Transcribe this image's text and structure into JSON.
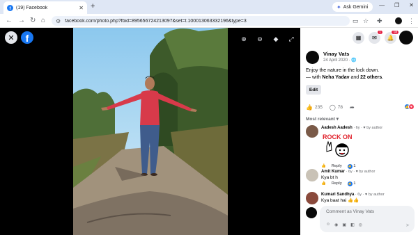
{
  "browser": {
    "tab_title": "(19) Facebook",
    "tab_close": "✕",
    "new_tab": "+",
    "ask_gemini": "Ask Gemini",
    "url": "facebook.com/photo.php?fbid=895656724213097&set=t.100013063332196&type=3",
    "window_controls": [
      "—",
      "❐",
      "✕"
    ]
  },
  "viewer": {
    "close_label": "✕",
    "logo": "f",
    "icons": [
      "zoom-in-icon",
      "zoom-out-icon",
      "tag-icon",
      "fullscreen-icon"
    ]
  },
  "header": {
    "messenger_badge": "1",
    "notifications_badge": "18"
  },
  "post": {
    "author": "Vinay Vats",
    "date": "24 April 2020 · ",
    "text": "Enjoy the nature in the lock down.",
    "with_prefix": "— with ",
    "with_name": "Neha Yadav",
    "with_and": " and ",
    "with_others": "22 others",
    "with_end": ".",
    "edit_label": "Edit",
    "likes": "235",
    "comments": "78"
  },
  "comments_section": {
    "sort_label": "Most relevant ▾",
    "items": [
      {
        "name": "Aadesh Aadesh",
        "meta": " · 6y · ",
        "by_author": "by author",
        "text": "",
        "sticker_text": "ROCK ON",
        "reply": "Reply",
        "react_count": "1"
      },
      {
        "name": "Amit Kumar",
        "meta": " · 6y · ",
        "by_author": "by author",
        "text": "Kya bt h",
        "reply": "Reply",
        "react_count": "1"
      },
      {
        "name": "Kumari Sandhya",
        "meta": " · 6y · ",
        "by_author": "by author",
        "text": "Kya baat hai 👍👍",
        "reply": "",
        "react_count": ""
      }
    ]
  },
  "composer": {
    "placeholder": "Comment as Vinay Vats"
  },
  "colors": {
    "brand": "#1877f2",
    "badge": "#e41e3f",
    "viewer_bg": "#000000"
  }
}
